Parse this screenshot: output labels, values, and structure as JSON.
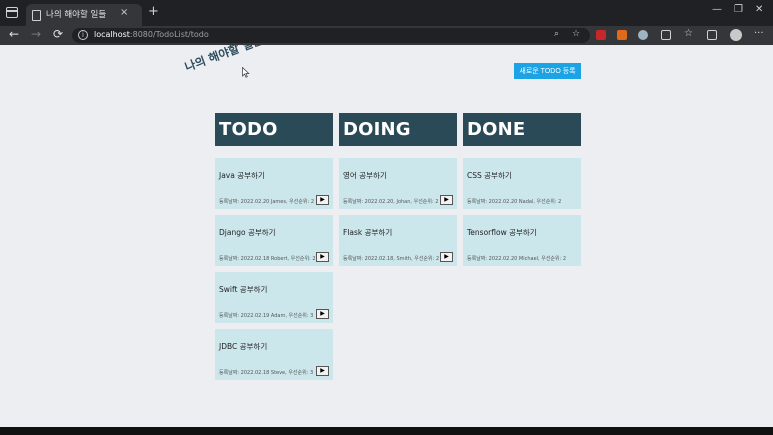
{
  "browser": {
    "tab_title": "나의 해야할 일들",
    "tab_close": "×",
    "new_tab": "+",
    "url_host": "localhost",
    "url_path": ":8080/TodoList/todo",
    "window_controls": [
      "—",
      "❐",
      "✕"
    ],
    "nav": [
      "←",
      "→",
      "⟳"
    ],
    "menu": "···"
  },
  "page": {
    "title": "나의 해야할 일들",
    "new_todo_label": "새로운 TODO 등록",
    "accent_color": "#1ba3e6",
    "header_color": "#2b4a57",
    "card_color": "#cce7ec"
  },
  "columns": [
    {
      "title": "TODO",
      "cards": [
        {
          "title": "Java 공부하기",
          "meta": "등록날짜: 2022.02.20 James, 우선순위: 2",
          "move": "▶"
        },
        {
          "title": "Django 공부하기",
          "meta": "등록날짜: 2022.02.18 Robert, 우선순위: 2",
          "move": "▶"
        },
        {
          "title": "Swift 공부하기",
          "meta": "등록날짜: 2022.02.19 Adam, 우선순위: 3",
          "move": "▶"
        },
        {
          "title": "JDBC 공부하기",
          "meta": "등록날짜: 2022.02.18 Steve, 우선순위: 3",
          "move": "▶"
        }
      ]
    },
    {
      "title": "DOING",
      "cards": [
        {
          "title": "영어 공부하기",
          "meta": "등록날짜: 2022.02.20, Johan, 우선순위: 2",
          "move": "▶"
        },
        {
          "title": "Flask 공부하기",
          "meta": "등록날짜: 2022.02.18, Smith, 우선순위: 2",
          "move": "▶"
        }
      ]
    },
    {
      "title": "DONE",
      "cards": [
        {
          "title": "CSS 공부하기",
          "meta": "등록날짜: 2022.02.20 Nadal, 우선순위: 2"
        },
        {
          "title": "Tensorflow 공부하기",
          "meta": "등록날짜: 2022.02.20 Michael, 우선순위: 2"
        }
      ]
    }
  ]
}
